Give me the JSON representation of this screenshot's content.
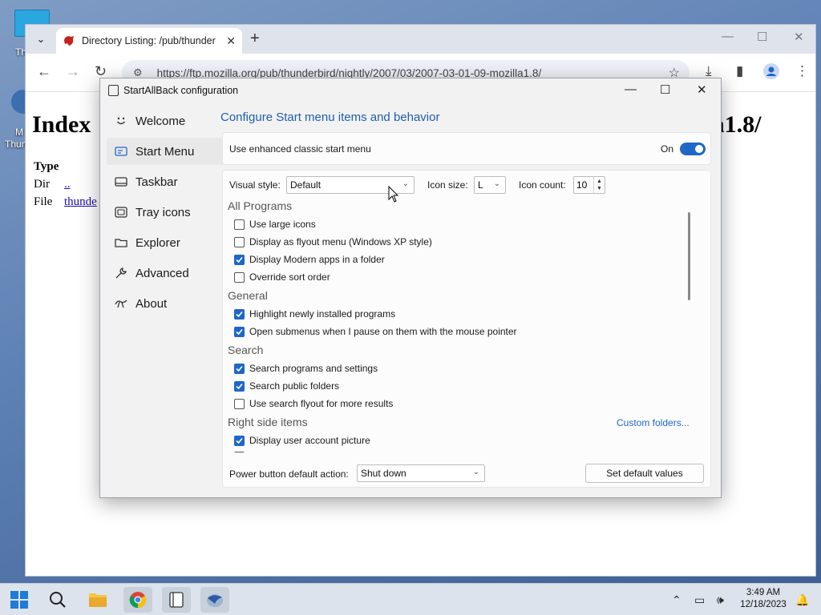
{
  "desktop": {
    "label_fragment_1": "Th",
    "label_fragment_2": "M",
    "label_fragment_3": "Thun"
  },
  "browser": {
    "tab_title": "Directory Listing: /pub/thunder",
    "url": "https://ftp.mozilla.org/pub/thunderbird/nightly/2007/03/2007-03-01-09-mozilla1.8/",
    "page": {
      "heading_left": "Index",
      "heading_right": "lla1.8/",
      "type_header": "Type",
      "rows": [
        {
          "type": "Dir",
          "name": ".."
        },
        {
          "type": "File",
          "name": "thunde"
        }
      ]
    }
  },
  "dialog": {
    "title": "StartAllBack configuration",
    "nav": [
      {
        "label": "Welcome",
        "icon": "smile-icon"
      },
      {
        "label": "Start Menu",
        "icon": "start-menu-icon"
      },
      {
        "label": "Taskbar",
        "icon": "taskbar-icon"
      },
      {
        "label": "Tray icons",
        "icon": "tray-icon"
      },
      {
        "label": "Explorer",
        "icon": "folder-icon"
      },
      {
        "label": "Advanced",
        "icon": "wrench-icon"
      },
      {
        "label": "About",
        "icon": "about-icon"
      }
    ],
    "selected_nav": "Start Menu",
    "heading": "Configure Start menu items and behavior",
    "enhanced": {
      "label": "Use enhanced classic start menu",
      "state": "On"
    },
    "visual_style": {
      "label": "Visual style:",
      "value": "Default"
    },
    "icon_size": {
      "label": "Icon size:",
      "value": "L"
    },
    "icon_count": {
      "label": "Icon count:",
      "value": "10"
    },
    "sections": [
      {
        "title": "All Programs",
        "options": [
          {
            "label": "Use large icons",
            "checked": false
          },
          {
            "label": "Display as flyout menu (Windows XP style)",
            "checked": false
          },
          {
            "label": "Display Modern apps in a folder",
            "checked": true
          },
          {
            "label": "Override sort order",
            "checked": false
          }
        ]
      },
      {
        "title": "General",
        "options": [
          {
            "label": "Highlight newly installed programs",
            "checked": true
          },
          {
            "label": "Open submenus when I pause on them with the mouse pointer",
            "checked": true
          }
        ]
      },
      {
        "title": "Search",
        "options": [
          {
            "label": "Search programs and settings",
            "checked": true
          },
          {
            "label": "Search public folders",
            "checked": true
          },
          {
            "label": "Use search flyout for more results",
            "checked": false
          }
        ]
      },
      {
        "title": "Right side items",
        "options": [
          {
            "label": "Display user account picture",
            "checked": true
          }
        ]
      }
    ],
    "custom_folders": "Custom folders...",
    "power": {
      "label": "Power button default action:",
      "value": "Shut down"
    },
    "set_default": "Set default values"
  },
  "taskbar": {
    "time": "3:49 AM",
    "date": "12/18/2023"
  },
  "colors": {
    "accent": "#1e66c8",
    "link": "#1f5fb0"
  }
}
